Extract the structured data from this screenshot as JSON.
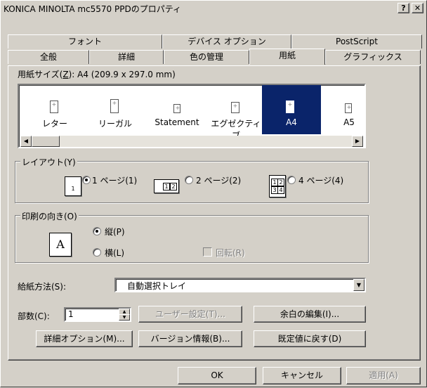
{
  "window": {
    "title": "KONICA MINOLTA mc5570 PPDのプロパティ",
    "help": "?",
    "close": "✕"
  },
  "tabs_back": [
    "フォント",
    "デバイス オプション",
    "PostScript"
  ],
  "tabs_front": [
    "全般",
    "詳細",
    "色の管理",
    "用紙",
    "グラフィックス"
  ],
  "paper": {
    "size_label": "用紙サイズ(",
    "size_key": "Z",
    "size_label_end": "):",
    "size_value": "A4 (209.9 x 297.0 mm)",
    "items": [
      "レター",
      "リーガル",
      "Statement",
      "エグゼクティブ",
      "A4",
      "A5"
    ],
    "selected": "A4"
  },
  "layout": {
    "title": "レイアウト(Y)",
    "opt1": "1 ページ(1)",
    "opt2": "2 ページ(2)",
    "opt4": "4 ページ(4)",
    "icon1": "1",
    "icon2a": "1",
    "icon2b": "2",
    "icon4a": "1",
    "icon4b": "2",
    "icon4c": "3",
    "icon4d": "4"
  },
  "orientation": {
    "title": "印刷の向き(O)",
    "icon_letter": "A",
    "portrait": "縦(P)",
    "landscape": "横(L)",
    "rotate": "回転(R)"
  },
  "source": {
    "label": "給紙方法(S):",
    "value": "自動選択トレイ"
  },
  "copies": {
    "label": "部数(C):",
    "value": "1"
  },
  "buttons": {
    "custom": "ユーザー設定(T)...",
    "margins": "余白の編集(I)...",
    "advanced": "詳細オプション(M)...",
    "version": "バージョン情報(B)...",
    "defaults": "既定値に戻す(D)",
    "ok": "OK",
    "cancel": "キャンセル",
    "apply": "適用(A)"
  }
}
